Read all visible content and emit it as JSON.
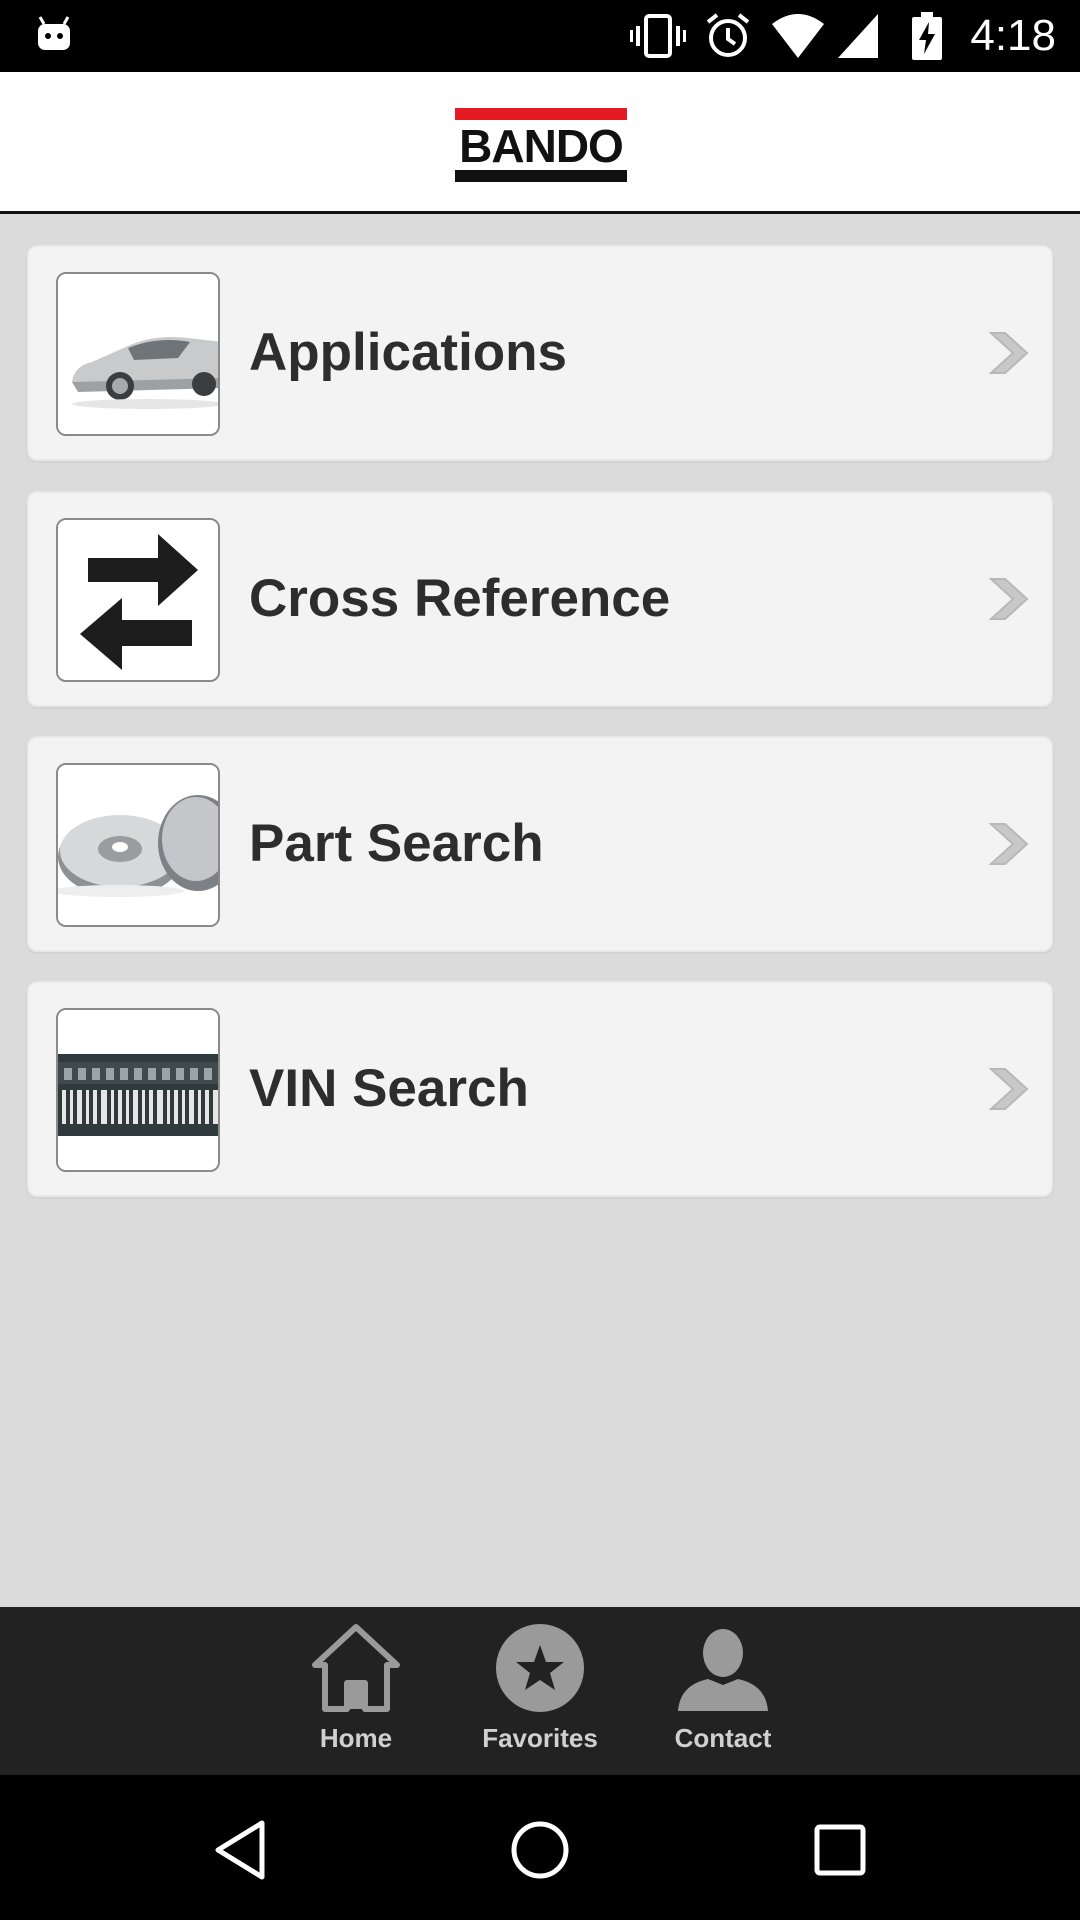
{
  "status_bar": {
    "time": "4:18",
    "icons": [
      "android-debug-icon",
      "vibrate-icon",
      "alarm-icon",
      "wifi-icon",
      "signal-icon",
      "battery-charging-icon"
    ]
  },
  "header": {
    "logo_text": "BANDO",
    "brand_colors": {
      "red": "#e51b24",
      "black": "#111111"
    }
  },
  "menu": {
    "items": [
      {
        "label": "Applications",
        "icon": "car-image-icon"
      },
      {
        "label": "Cross Reference",
        "icon": "swap-arrows-icon"
      },
      {
        "label": "Part Search",
        "icon": "brake-disc-image-icon"
      },
      {
        "label": "VIN Search",
        "icon": "vin-barcode-image-icon"
      }
    ]
  },
  "tabbar": {
    "tabs": [
      {
        "label": "Home",
        "icon": "home-icon"
      },
      {
        "label": "Favorites",
        "icon": "star-icon"
      },
      {
        "label": "Contact",
        "icon": "person-icon"
      }
    ]
  },
  "navbar": {
    "buttons": [
      "back-icon",
      "home-circle-icon",
      "recents-icon"
    ]
  }
}
